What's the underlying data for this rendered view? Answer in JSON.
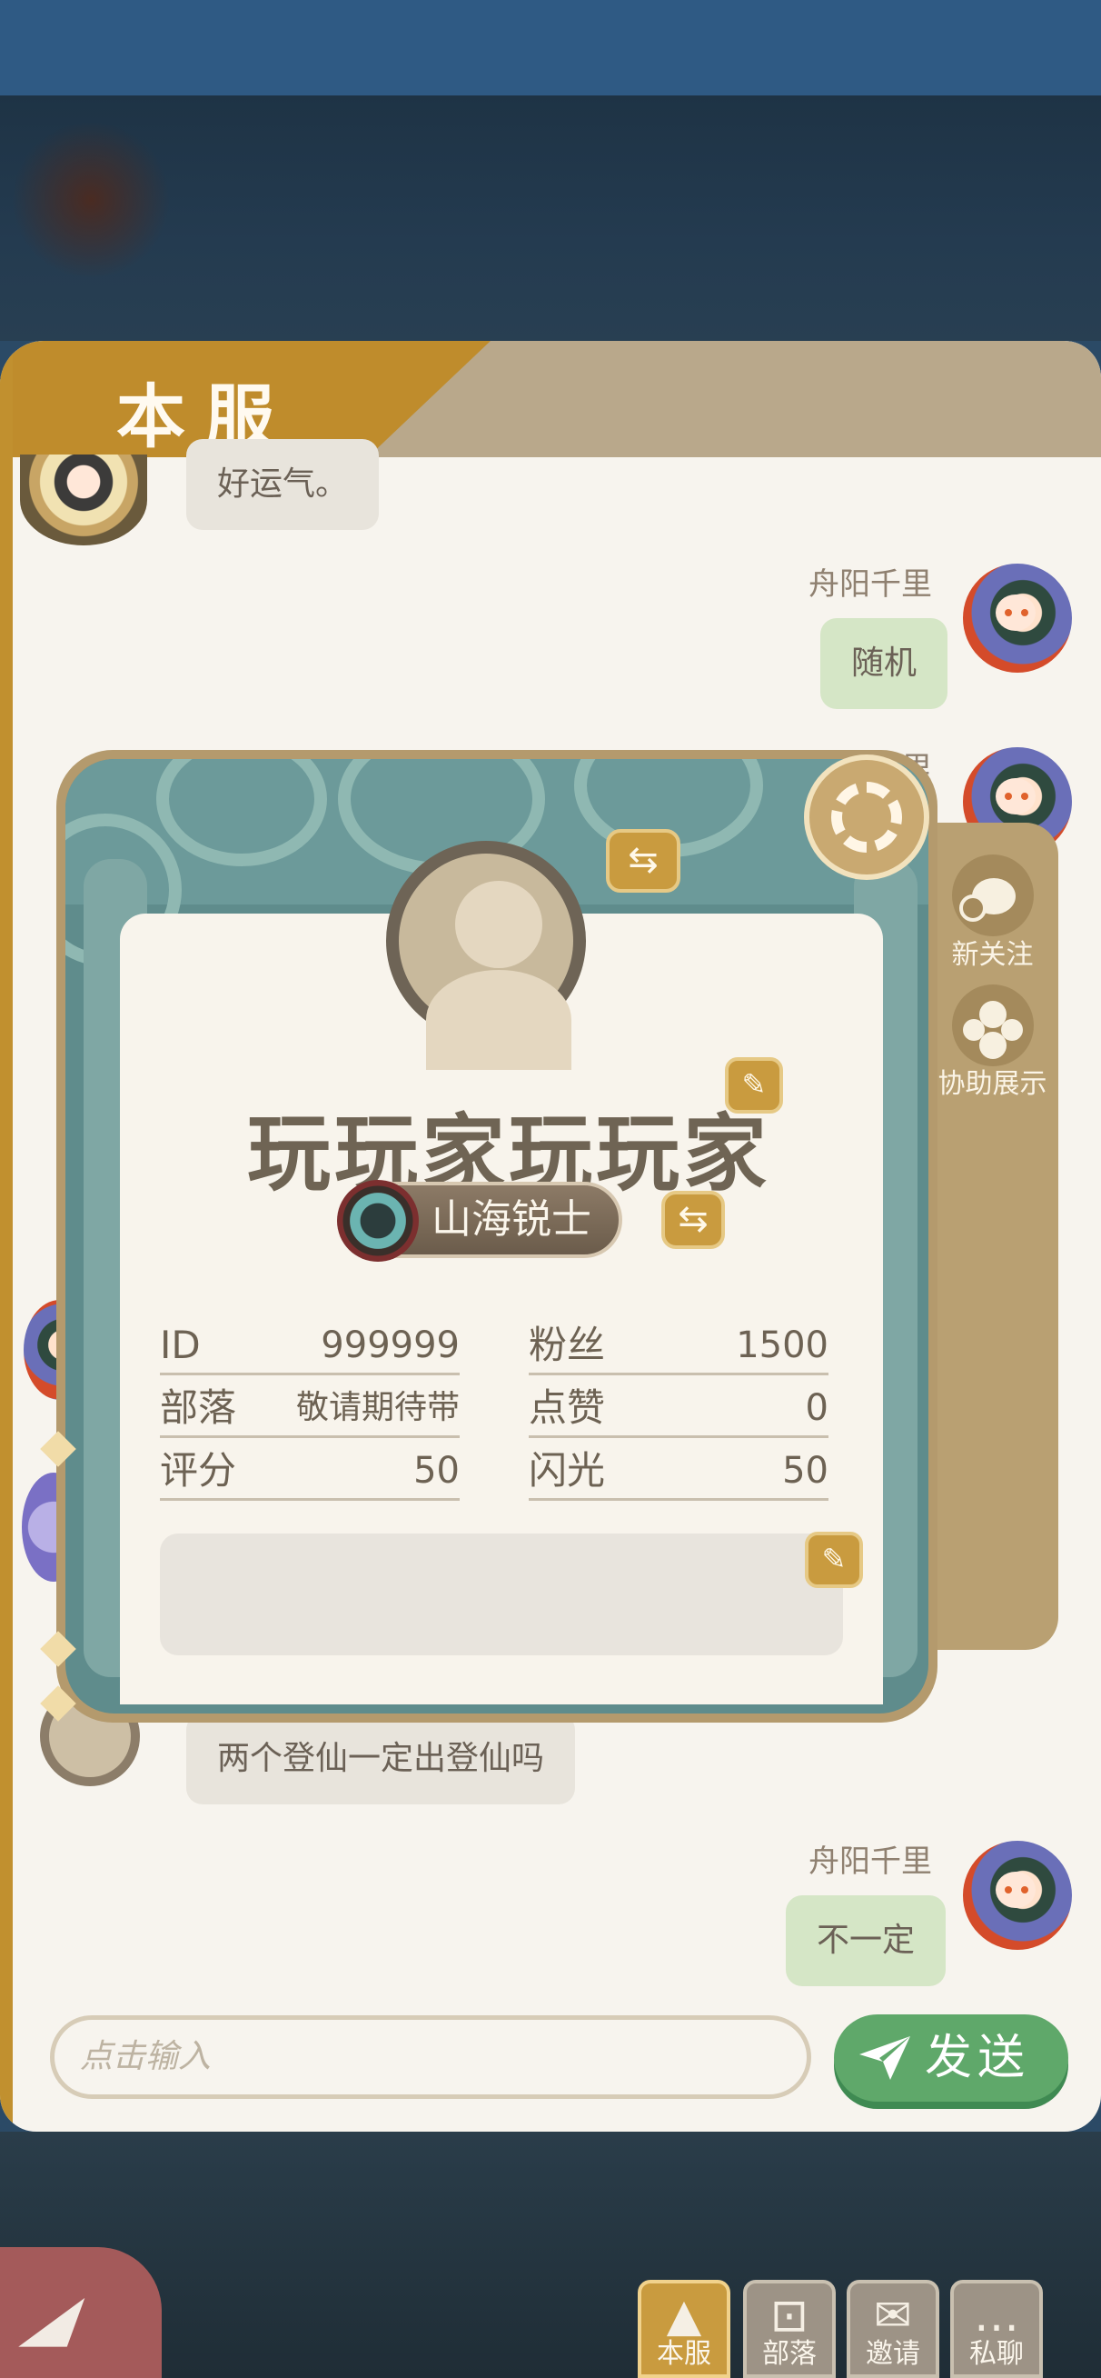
{
  "header": {
    "title": "本服"
  },
  "messages": [
    {
      "text": "好运气。",
      "sender": ""
    },
    {
      "name": "舟阳千里",
      "text": "随机"
    },
    {
      "name": "舟阳千里",
      "text": ""
    },
    {
      "text": "两个登仙一定出登仙吗",
      "sender": ""
    },
    {
      "name": "舟阳千里",
      "text": "不一定"
    }
  ],
  "side_actions": {
    "follow": "新关注",
    "assist": "协助展示"
  },
  "profile": {
    "name": "玩玩家玩玩家",
    "title": "山海锐士",
    "stats": [
      {
        "key": "ID",
        "value": "999999"
      },
      {
        "key": "粉丝",
        "value": "1500"
      },
      {
        "key": "部落",
        "value": "敬请期待带"
      },
      {
        "key": "点赞",
        "value": "0"
      },
      {
        "key": "评分",
        "value": "50"
      },
      {
        "key": "闪光",
        "value": "50"
      }
    ]
  },
  "input": {
    "placeholder": "点击输入"
  },
  "send": {
    "label": "发送"
  },
  "bottom_nav": [
    {
      "label": "本服",
      "icon": "mountain-icon",
      "active": true
    },
    {
      "label": "部落",
      "icon": "tribe-icon",
      "active": false
    },
    {
      "label": "邀请",
      "icon": "envelope-icon",
      "active": false
    },
    {
      "label": "私聊",
      "icon": "chat-bubble-icon",
      "active": false
    }
  ],
  "colors": {
    "accent": "#bf8c2c",
    "send": "#5fa86a",
    "panel": "#f7f4ee",
    "card_teal": "#5f8c8c"
  }
}
